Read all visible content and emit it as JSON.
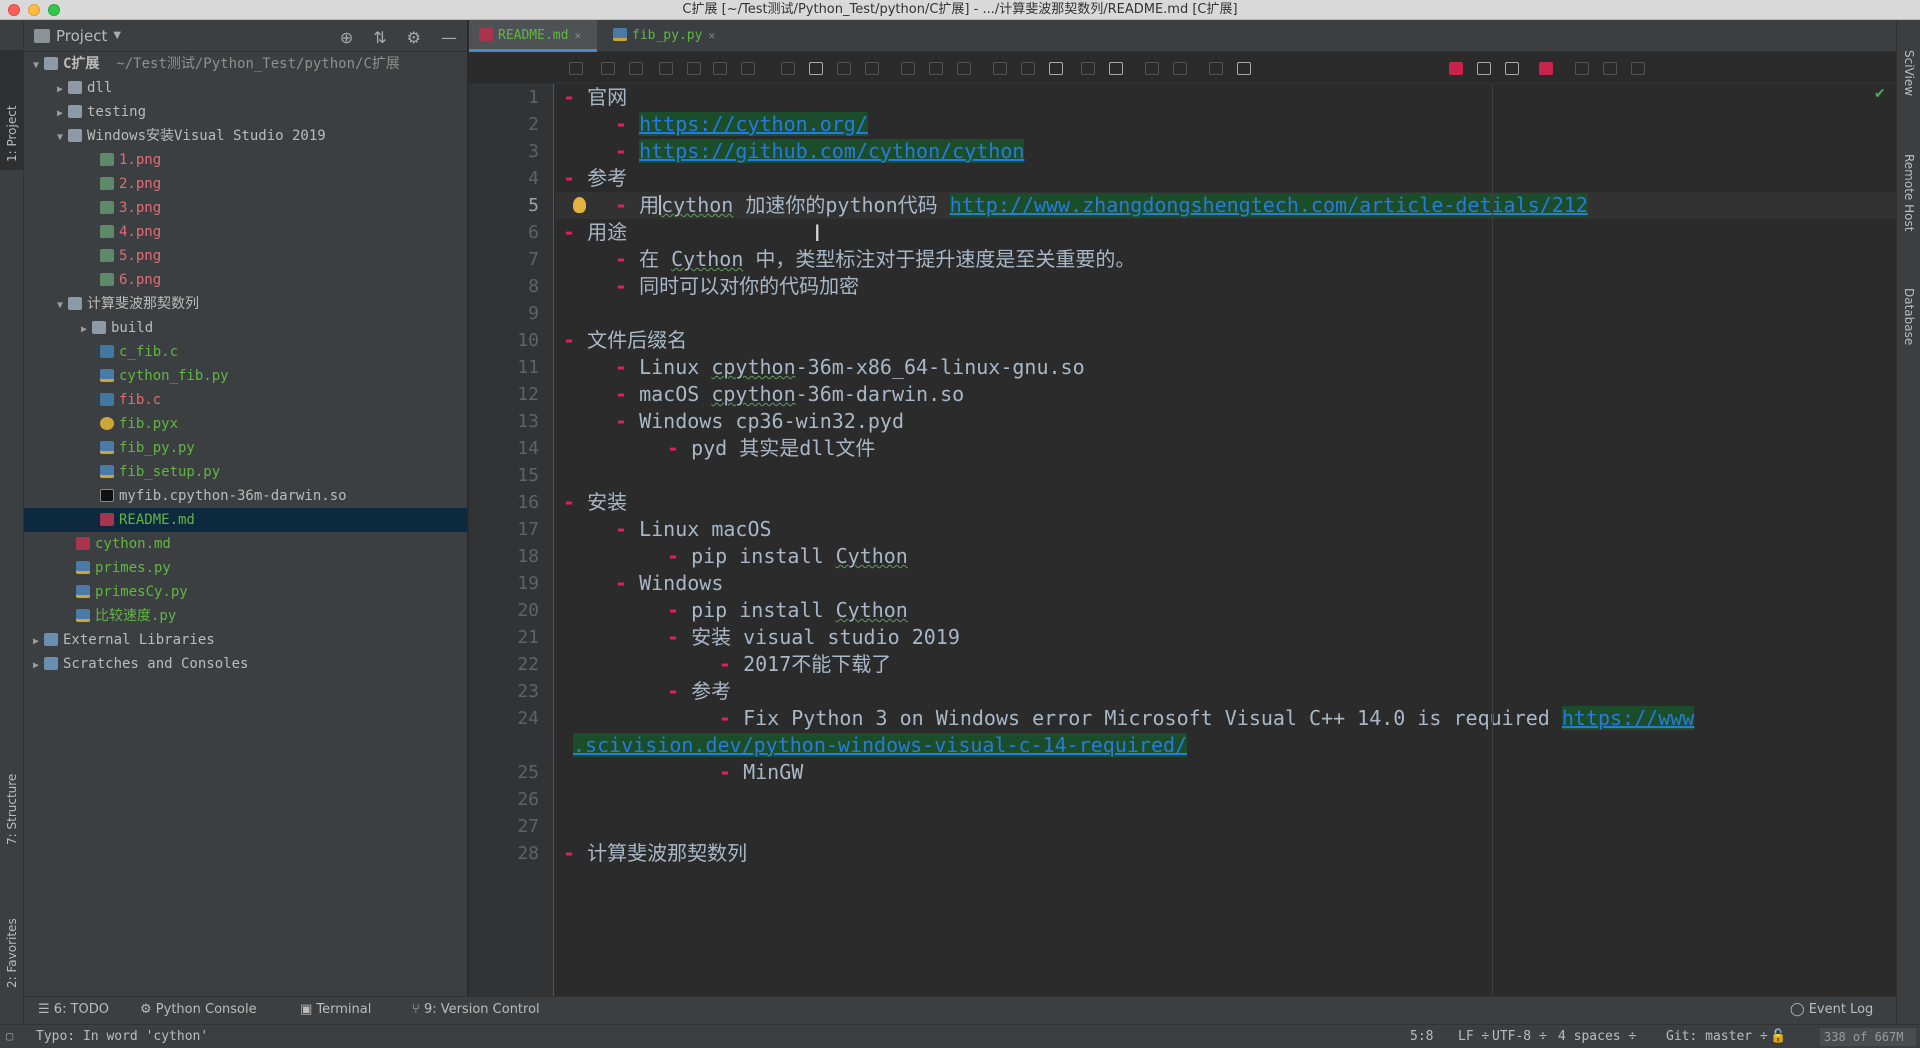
{
  "window": {
    "title": "C扩展 [~/Test测试/Python_Test/python/C扩展] - .../计算斐波那契数列/README.md [C扩展]"
  },
  "left_strip": {
    "project_tab": "1: Project",
    "structure_tab": "7: Structure",
    "favorites_tab": "2: Favorites"
  },
  "right_strip": {
    "tabs": [
      "SciView",
      "Remote Host",
      "Database"
    ]
  },
  "project_panel": {
    "title": "Project",
    "tree": [
      {
        "label": "C扩展",
        "hint": "~/Test测试/Python_Test/python/C扩展"
      },
      {
        "label": "dll"
      },
      {
        "label": "testing"
      },
      {
        "label": "Windows安装Visual Studio 2019"
      },
      {
        "label": "1.png"
      },
      {
        "label": "2.png"
      },
      {
        "label": "3.png"
      },
      {
        "label": "4.png"
      },
      {
        "label": "5.png"
      },
      {
        "label": "6.png"
      },
      {
        "label": "计算斐波那契数列"
      },
      {
        "label": "build"
      },
      {
        "label": "c_fib.c"
      },
      {
        "label": "cython_fib.py"
      },
      {
        "label": "fib.c"
      },
      {
        "label": "fib.pyx"
      },
      {
        "label": "fib_py.py"
      },
      {
        "label": "fib_setup.py"
      },
      {
        "label": "myfib.cpython-36m-darwin.so"
      },
      {
        "label": "README.md"
      },
      {
        "label": "cython.md"
      },
      {
        "label": "primes.py"
      },
      {
        "label": "primesCy.py"
      },
      {
        "label": "比较速度.py"
      },
      {
        "label": "External Libraries"
      },
      {
        "label": "Scratches and Consoles"
      }
    ]
  },
  "editor": {
    "tabs": [
      {
        "label": "README.md",
        "active": true
      },
      {
        "label": "fib_py.py",
        "active": false
      }
    ],
    "line_numbers": [
      "1",
      "2",
      "3",
      "4",
      "5",
      "6",
      "7",
      "8",
      "9",
      "10",
      "11",
      "12",
      "13",
      "14",
      "15",
      "16",
      "17",
      "18",
      "19",
      "20",
      "21",
      "22",
      "23",
      "24",
      "25",
      "26",
      "27",
      "28"
    ],
    "lines": {
      "l1": "官网",
      "l2": "https://cython.org/",
      "l3": "https://github.com/cython/cython",
      "l4": "参考",
      "l5a": "用",
      "l5b": "cython",
      "l5c": " 加速你的python代码 ",
      "l5link": "http://www.zhangdongshengtech.com/article-detials/212",
      "l6": "用途",
      "l7a": "在 ",
      "l7b": "Cython",
      "l7c": " 中，类型标注对于提升速度是至关重要的。",
      "l8": "同时可以对你的代码加密",
      "l10": "文件后缀名",
      "l11a": "Linux ",
      "l11b": "cpython",
      "l11c": "-36m-x86_64-linux-gnu.so",
      "l12a": "macOS ",
      "l12b": "cpython",
      "l12c": "-36m-darwin.so",
      "l13": "Windows cp36-win32.pyd",
      "l14": "pyd 其实是dll文件",
      "l16": "安装",
      "l17": "Linux macOS",
      "l18a": "pip install ",
      "l18b": "Cython",
      "l19": "Windows",
      "l20a": "pip install ",
      "l20b": "Cython",
      "l21": "安装 visual studio 2019",
      "l22": "2017不能下载了",
      "l23": "参考",
      "l24a": "Fix Python 3 on Windows error Microsoft Visual C++ 14.0 is required ",
      "l24link1": "https://www",
      "l24link2": ".scivision.dev/python-windows-visual-c-14-required/",
      "l25": "MinGW",
      "l28": "计算斐波那契数列"
    }
  },
  "bottom_tools": {
    "todo": "6: TODO",
    "python_console": "Python Console",
    "terminal": "Terminal",
    "version_control": "9: Version Control",
    "event_log": "Event Log"
  },
  "status": {
    "message": "Typo: In word 'cython'",
    "position": "5:8",
    "line_sep": "LF ÷",
    "encoding": "UTF-8 ÷",
    "indent": "4 spaces ÷",
    "git": "Git: master ÷",
    "memory": "338 of 667M"
  }
}
